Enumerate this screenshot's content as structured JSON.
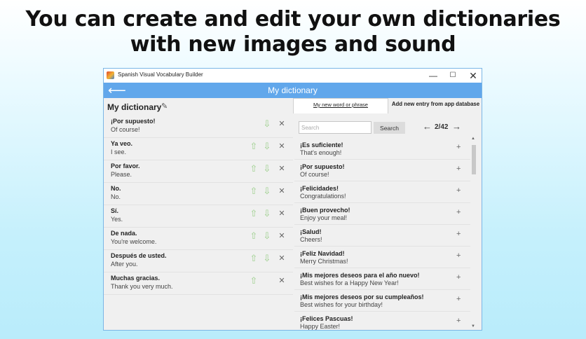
{
  "headline": {
    "line1": "You can create and edit your own dictionaries",
    "line2": "with new images and sound"
  },
  "window": {
    "title": "Spanish Visual Vocabulary Builder",
    "controls": {
      "minimize": "—",
      "maximize": "☐",
      "close": "✕"
    }
  },
  "appbar": {
    "title": "My dictionary",
    "back_icon": "arrow-left-icon"
  },
  "left": {
    "title": "My dictionary",
    "items": [
      {
        "es": "¡Por supuesto!",
        "en": "Of course!",
        "up": false,
        "down": true
      },
      {
        "es": "Ya veo.",
        "en": "I see.",
        "up": true,
        "down": true
      },
      {
        "es": "Por favor.",
        "en": "Please.",
        "up": true,
        "down": true
      },
      {
        "es": "No.",
        "en": "No.",
        "up": true,
        "down": true
      },
      {
        "es": "Sí.",
        "en": "Yes.",
        "up": true,
        "down": true
      },
      {
        "es": "De nada.",
        "en": "You're welcome.",
        "up": true,
        "down": true
      },
      {
        "es": "Después de usted.",
        "en": "After you.",
        "up": true,
        "down": true
      },
      {
        "es": "Muchas gracias.",
        "en": "Thank you very much.",
        "up": true,
        "down": false
      }
    ]
  },
  "right": {
    "tabs": {
      "new_word": "My new word or phrase",
      "from_db": "Add new entry from app database"
    },
    "search": {
      "placeholder": "Search",
      "button": "Search"
    },
    "pagination": "2/42",
    "items": [
      {
        "es": "¡Es suficiente!",
        "en": "That's enough!"
      },
      {
        "es": "¡Por supuesto!",
        "en": "Of course!"
      },
      {
        "es": "¡Felicidades!",
        "en": "Congratulations!"
      },
      {
        "es": "¡Buen provecho!",
        "en": "Enjoy your meal!"
      },
      {
        "es": "¡Salud!",
        "en": "Cheers!"
      },
      {
        "es": "¡Feliz Navidad!",
        "en": "Merry Christmas!"
      },
      {
        "es": "¡Mis mejores deseos para el año nuevo!",
        "en": "Best wishes for a Happy New Year!"
      },
      {
        "es": "¡Mis mejores deseos por su cumpleaños!",
        "en": "Best wishes for your birthday!"
      },
      {
        "es": "¡Felices Pascuas!",
        "en": "Happy Easter!"
      }
    ]
  },
  "colors": {
    "accent": "#61a7eb",
    "arrow_green": "#9ccf8c",
    "background": "#c5f0fc"
  }
}
